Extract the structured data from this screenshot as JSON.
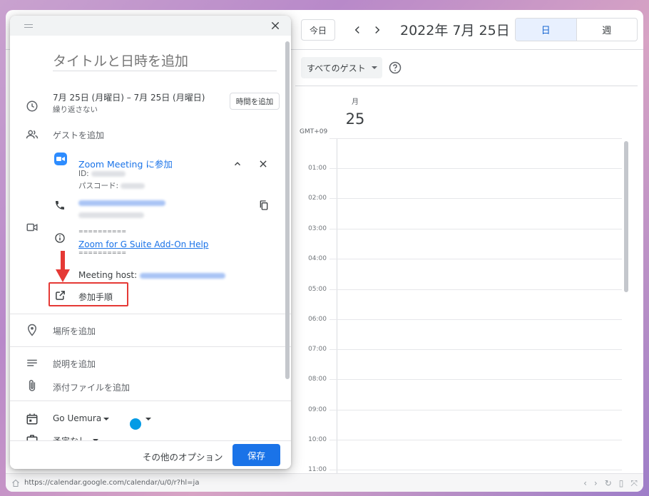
{
  "toolbar": {
    "today_label": "今日",
    "date_title": "2022年 7月 25日",
    "view_day": "日",
    "view_week": "週"
  },
  "filter": {
    "guests_label": "すべてのゲスト"
  },
  "day_header": {
    "dow": "月",
    "day_number": "25"
  },
  "timezone": "GMT+09",
  "hours": [
    "01:00",
    "02:00",
    "03:00",
    "04:00",
    "05:00",
    "06:00",
    "07:00",
    "08:00",
    "09:00",
    "10:00",
    "11:00"
  ],
  "dialog": {
    "title_placeholder": "タイトルと日時を追加",
    "date_range": "7月 25日 (月曜日)  –  7月 25日 (月曜日)",
    "repeat": "繰り返さない",
    "add_time_button": "時間を追加",
    "add_guests": "ゲストを追加",
    "zoom": {
      "join_link": "Zoom Meeting に参加",
      "id_label": "ID: ",
      "passcode_label": "パスコード: ",
      "divider_text": "==========",
      "help_link": "Zoom for G Suite Add-On Help",
      "host_label": "Meeting host: ",
      "join_instructions": "参加手順"
    },
    "add_location": "場所を追加",
    "add_description": "説明を追加",
    "add_attachment": "添付ファイルを追加",
    "calendar_owner": "Go Uemura",
    "busy_status": "予定なし",
    "more_options": "その他のオプション",
    "save_button": "保存",
    "calendar_color": "#039be5"
  },
  "statusbar": {
    "url": "https://calendar.google.com/calendar/u/0/r?hl=ja"
  }
}
